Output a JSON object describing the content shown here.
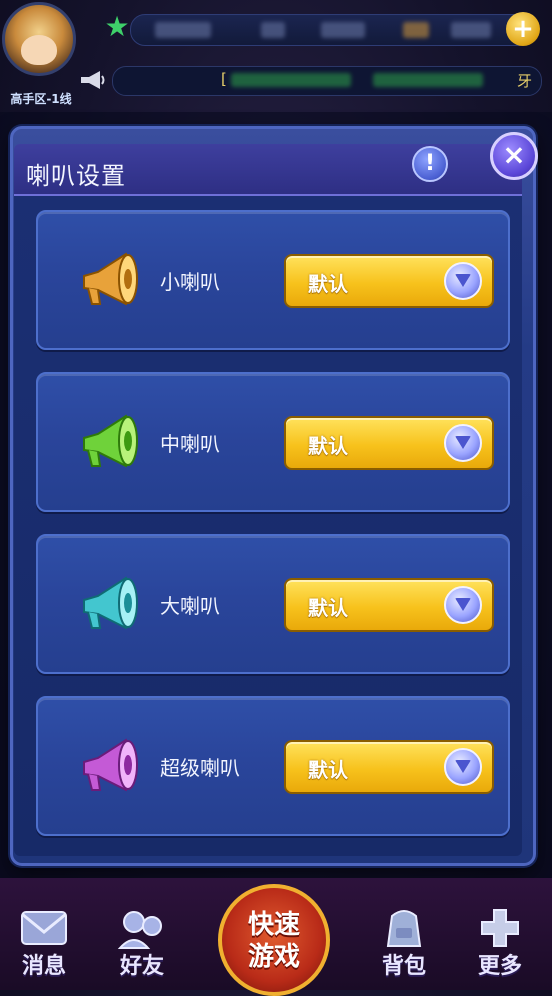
{
  "header": {
    "area_label": "高手区-1线",
    "notice_left_char": "[",
    "notice_right_char": "牙"
  },
  "dialog": {
    "title": "喇叭设置",
    "info_symbol": "!",
    "close_symbol": "×",
    "items": [
      {
        "label": "小喇叭",
        "value": "默认",
        "color": "#e8a23a"
      },
      {
        "label": "中喇叭",
        "value": "默认",
        "color": "#6fd23a"
      },
      {
        "label": "大喇叭",
        "value": "默认",
        "color": "#43c6cf"
      },
      {
        "label": "超级喇叭",
        "value": "默认",
        "color": "#c45ad6"
      }
    ]
  },
  "bottom_nav": {
    "messages": "消息",
    "friends": "好友",
    "quick_play_line1": "快速",
    "quick_play_line2": "游戏",
    "backpack": "背包",
    "more": "更多"
  },
  "colors": {
    "toggle": "#f7c21c",
    "panel": "#2a459b",
    "close": "#5b47d8"
  },
  "icons": [
    "star-icon",
    "plus-icon",
    "loudspeaker-icon",
    "info-icon",
    "close-icon",
    "envelope-icon",
    "friends-icon",
    "backpack-icon",
    "plus-more-icon"
  ]
}
